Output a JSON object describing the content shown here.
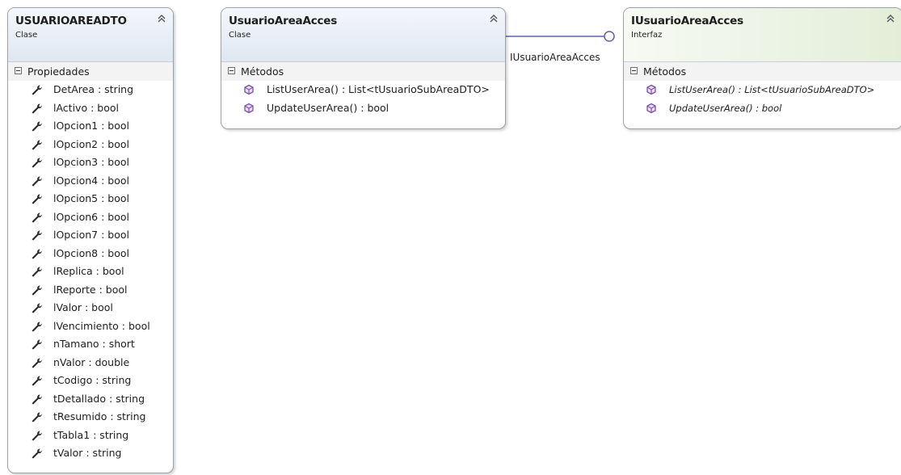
{
  "classes": [
    {
      "name": "USUARIOAREADTO",
      "stereotype": "Clase",
      "section_label": "Propiedades",
      "members": [
        "DetArea : string",
        "lActivo : bool",
        "lOpcion1 : bool",
        "lOpcion2 : bool",
        "lOpcion3 : bool",
        "lOpcion4 : bool",
        "lOpcion5 : bool",
        "lOpcion6 : bool",
        "lOpcion7 : bool",
        "lOpcion8 : bool",
        "lReplica : bool",
        "lReporte : bool",
        "lValor : bool",
        "lVencimiento : bool",
        "nTamano : short",
        "nValor : double",
        "tCodigo : string",
        "tDetallado : string",
        "tResumido : string",
        "tTabla1 : string",
        "tValor : string"
      ],
      "member_icon": "wrench-property-icon"
    },
    {
      "name": "UsuarioAreaAcces",
      "stereotype": "Clase",
      "section_label": "Métodos",
      "members": [
        "ListUserArea() : List<tUsuarioSubAreaDTO>",
        "UpdateUserArea() : bool"
      ],
      "member_icon": "method-cube-icon"
    },
    {
      "name": "IUsuarioAreaAcces",
      "stereotype": "Interfaz",
      "section_label": "Métodos",
      "members": [
        "ListUserArea() : List<tUsuarioSubAreaDTO>",
        "UpdateUserArea() : bool"
      ],
      "member_icon": "method-cube-icon"
    }
  ],
  "connector": {
    "label": "IUsuarioAreaAcces",
    "kind": "lollipop-interface-implementation"
  },
  "colors": {
    "class_header": "#dfe7f2",
    "interface_header": "#e3eed8",
    "border": "#9aa2ad",
    "connector": "#5f63a8",
    "method_icon": "#7b4fa3"
  }
}
